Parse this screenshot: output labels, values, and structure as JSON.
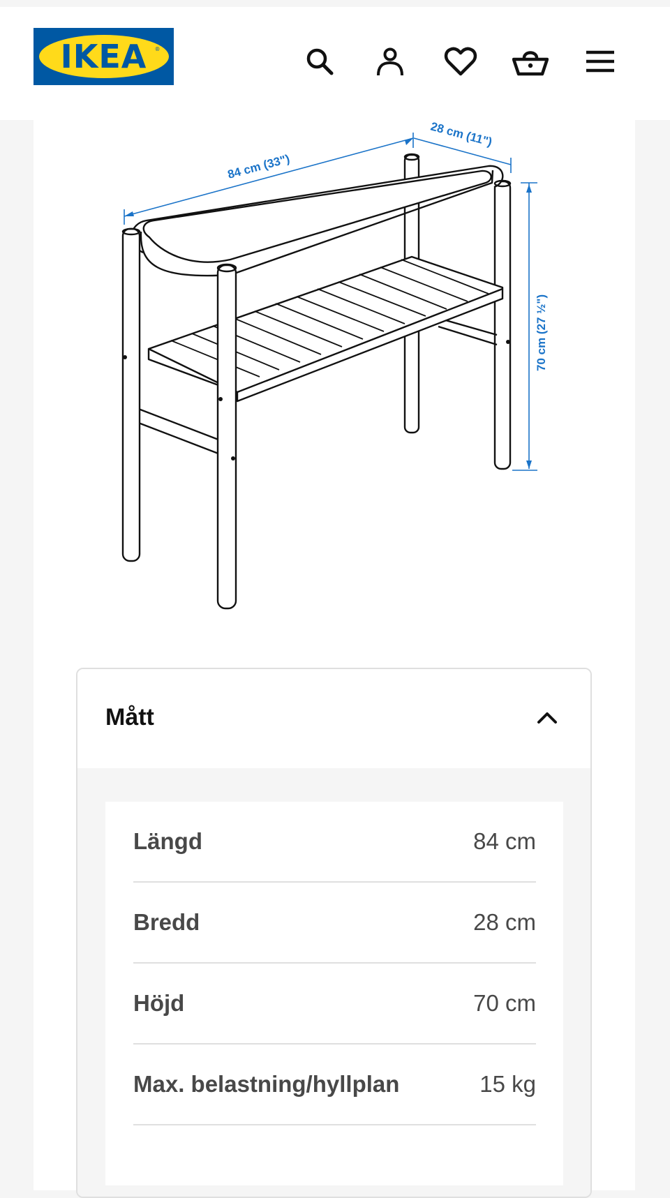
{
  "header": {
    "logo_text": "IKEA",
    "logo_reg": "®",
    "icons": [
      "search-icon",
      "account-icon",
      "heart-icon",
      "basket-icon",
      "menu-icon"
    ]
  },
  "drawing": {
    "length_label": "84 cm (33\")",
    "depth_label": "28 cm (11\")",
    "height_label": "70 cm (27 ½\")"
  },
  "dimensions": {
    "title": "Mått",
    "rows": [
      {
        "label": "Längd",
        "value": "84 cm"
      },
      {
        "label": "Bredd",
        "value": "28 cm"
      },
      {
        "label": "Höjd",
        "value": "70 cm"
      },
      {
        "label": "Max. belastning/hyllplan",
        "value": "15 kg"
      }
    ]
  },
  "colors": {
    "brand_blue": "#0058a3",
    "brand_yellow": "#ffda1a",
    "dimension_blue": "#1a73c8"
  }
}
